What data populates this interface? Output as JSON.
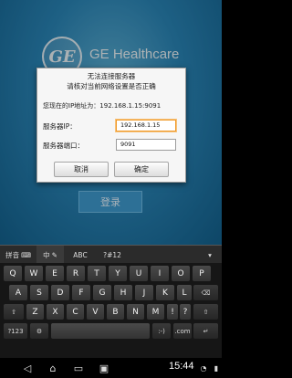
{
  "app": {
    "logo_text": "GE",
    "brand": "GE Healthcare",
    "login_label": "登录"
  },
  "dialog": {
    "title": "无法连接服务器",
    "subtitle": "请核对当前网络设置是否正确",
    "current_ip": "您现在的IP地址为：192.168.1.15:9091",
    "server_ip_label": "服务器IP：",
    "server_ip_value": "192.168.1.15",
    "server_port_label": "服务器端口：",
    "server_port_value": "9091",
    "cancel_label": "取消",
    "confirm_label": "确定"
  },
  "ime": {
    "items": [
      "拼音",
      "中",
      "ABC",
      "?#12"
    ]
  },
  "keyboard": {
    "row1": [
      "Q",
      "W",
      "E",
      "R",
      "T",
      "Y",
      "U",
      "I",
      "O",
      "P"
    ],
    "row2": [
      "A",
      "S",
      "D",
      "F",
      "G",
      "H",
      "J",
      "K",
      "L"
    ],
    "row3": [
      "Z",
      "X",
      "C",
      "V",
      "B",
      "N",
      "M",
      "!",
      "?"
    ],
    "row4_left": [
      "?123",
      "⚙"
    ],
    "row4_right": [
      ":-)",
      ".com"
    ],
    "enter": "↵",
    "backspace": "⌫"
  },
  "status": {
    "time": "15:44"
  },
  "colors": {
    "accent_focus": "#f09a2a",
    "app_blue": "#2a86b8"
  },
  "icons": [
    "back-icon",
    "home-icon",
    "recent-apps-icon",
    "screenshot-icon",
    "wifi-icon",
    "battery-icon"
  ]
}
